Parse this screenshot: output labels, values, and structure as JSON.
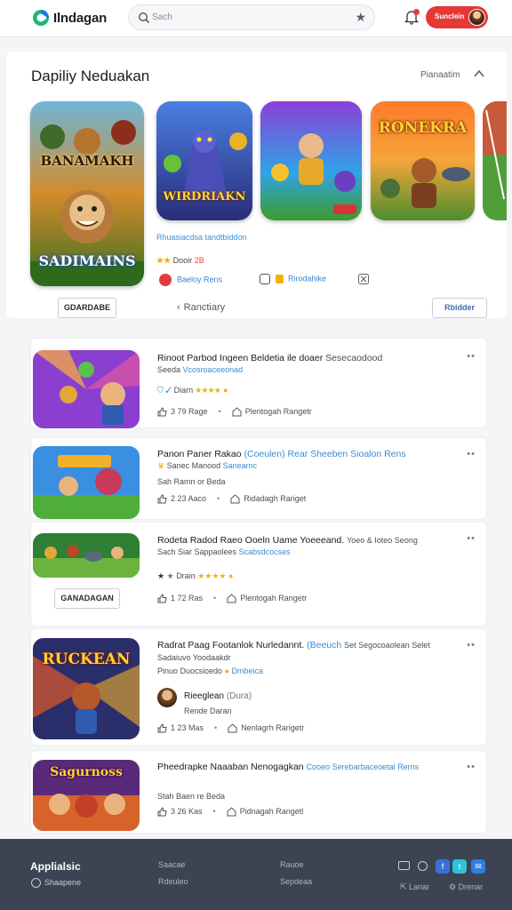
{
  "header": {
    "logo_text": "Ilndagan",
    "search_placeholder": "Sach",
    "profile_label": "Sunclein",
    "colors": {
      "accent": "#e53935",
      "logo_green": "#1fb57a",
      "logo_blue": "#1877f2"
    }
  },
  "featured": {
    "title": "Dapiliy Neduakan",
    "view_link": "Pianaatim",
    "tiles": [
      {
        "line1": "BANAMAKH",
        "line2": "SADIMAINS"
      },
      {
        "line1": "WIRDRIAKN",
        "line2": ""
      },
      {
        "line1": "",
        "line2": ""
      },
      {
        "line1": "RONEKRA",
        "line2": ""
      },
      {
        "line1": "",
        "line2": ""
      }
    ],
    "subtitle": "Rhuasiacdsa tandtbiddon",
    "rating_stars": "★★",
    "rating_label": "Dooir",
    "rating_badge": "2B",
    "chip1": "Baeloy Rens",
    "chip2": "Rirodahike",
    "left_button": "GDARDABE",
    "pager_label": "Ranctiary",
    "right_button": "Rbidder"
  },
  "items": [
    {
      "title": "Rinoot Parbod Ingeen Beldetia ile doaer",
      "title_tail": "Sesecaodood",
      "line2_a": "Seeda",
      "line2_b": "Vcosroaceeonad",
      "rating_label": "Diarn",
      "stars": "★★★★",
      "likes": "3 79 Rage",
      "category": "Plentogah Rangetr",
      "more": "••"
    },
    {
      "title": "Panon Paner Rakao",
      "title_blue": "(Coeulen) Rear Sheeben Sioalon Rens",
      "line2_a": "Sanec Manood",
      "line2_b": "Sanearnc",
      "line3": "Sah Ramn or Beda",
      "likes": "2 23 Aaco",
      "category": "Ridadagh Rariget",
      "more": "••"
    },
    {
      "title": "Rodeta Radod Raeo Ooeln Uame Yoeeeand.",
      "title_tail": "Yoeo & Ioteo Seong",
      "line2_a": "Sach Siar Sappaolees",
      "line2_b": "Scabsdcocses",
      "rating_label": "Drain",
      "stars": "★★★★",
      "likes": "1 72 Ras",
      "category": "Plentogah Rangetr",
      "button": "GANADAGAN",
      "more": "••"
    },
    {
      "title": "Radrat Paag Footanlok Nurledannt.",
      "title_blue": "(Beeuch",
      "title_tail": "Set Segocoaolean Selet",
      "line2_a": "Sadaiuvo Yoodaakdr",
      "line3": "Pinuo Duocsioedo",
      "line3_blue": "Dmbeica",
      "author": "Rieeglean",
      "author_tail": "(Dura)",
      "author_sub": "Rende Daran",
      "likes": "1 23 Mas",
      "category": "Nenlagrh Rarigetr",
      "more": "••"
    },
    {
      "title": "Pheedrapke Naaaban Nenogagkan",
      "title_blue": "Cooeo Serebarbaceoetal Rerns",
      "line2_a": "Stah Baen re Beda",
      "likes": "3 26 Kas",
      "category": "Pidnagah Rangetl",
      "more": "••"
    }
  ],
  "footer": {
    "brand": "Applialsic",
    "sub": "Shaapene",
    "col1_a": "Saacae",
    "col1_b": "Rdeuleo",
    "col2_a": "Rauoe",
    "col2_b": "Sepdeaa",
    "lang1": "Lariar",
    "lang2": "Drenar"
  }
}
